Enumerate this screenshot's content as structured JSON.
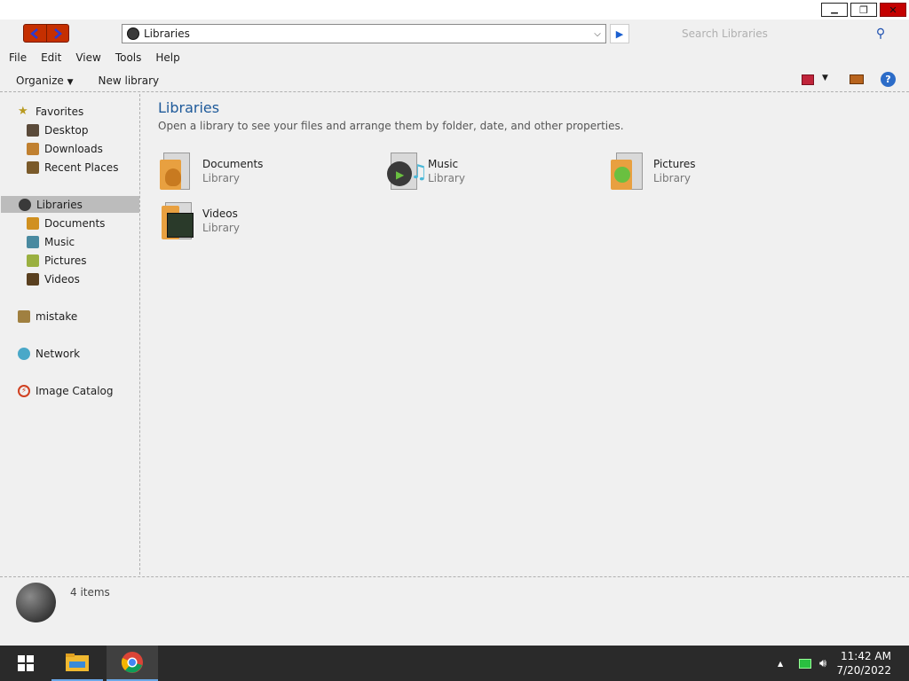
{
  "window": {
    "minimize_glyph": "▁",
    "maximize_glyph": "❐",
    "close_glyph": "✕"
  },
  "address": {
    "value": "Libraries",
    "icon": "libraries-icon"
  },
  "search": {
    "placeholder": "Search Libraries"
  },
  "menu": [
    "File",
    "Edit",
    "View",
    "Tools",
    "Help"
  ],
  "toolbar": {
    "organize": "Organize",
    "new_library": "New library"
  },
  "nav": {
    "favorites": "Favorites",
    "desktop": "Desktop",
    "downloads": "Downloads",
    "recent": "Recent Places",
    "libraries": "Libraries",
    "documents": "Documents",
    "music": "Music",
    "pictures": "Pictures",
    "videos": "Videos",
    "mistake": "mistake",
    "network": "Network",
    "image_catalog": "Image Catalog"
  },
  "content": {
    "title": "Libraries",
    "description": "Open a library to see your files and arrange them by folder, date, and other properties.",
    "libraries": [
      {
        "name": "Documents",
        "type": "Library"
      },
      {
        "name": "Music",
        "type": "Library"
      },
      {
        "name": "Pictures",
        "type": "Library"
      },
      {
        "name": "Videos",
        "type": "Library"
      }
    ]
  },
  "status": {
    "count": "4 items"
  },
  "taskbar": {
    "time": "11:42 AM",
    "date": "7/20/2022"
  },
  "colors": {
    "accent_title": "#1e5a9a",
    "selection": "#bcbcbc",
    "close_button": "#c40000",
    "nav_buttons": "#c52f00",
    "taskbar": "#2a2a2a"
  }
}
